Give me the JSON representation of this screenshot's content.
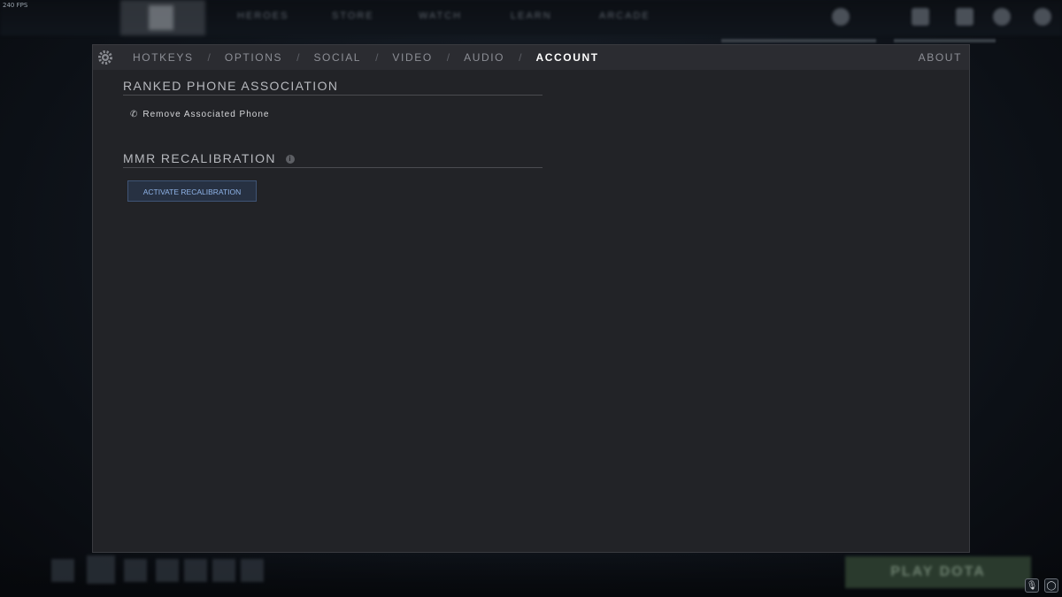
{
  "overlay": {
    "fps": "240 FPS",
    "nav_items": [
      "HEROES",
      "STORE",
      "WATCH",
      "LEARN",
      "ARCADE"
    ],
    "play_button": "PLAY DOTA"
  },
  "settings": {
    "tabs": [
      {
        "label": "HOTKEYS",
        "active": false
      },
      {
        "label": "OPTIONS",
        "active": false
      },
      {
        "label": "SOCIAL",
        "active": false
      },
      {
        "label": "VIDEO",
        "active": false
      },
      {
        "label": "AUDIO",
        "active": false
      },
      {
        "label": "ACCOUNT",
        "active": true
      }
    ],
    "separator": "/",
    "about": "ABOUT",
    "ranked_phone": {
      "title": "RANKED PHONE ASSOCIATION",
      "remove_link": "Remove Associated Phone"
    },
    "mmr": {
      "title": "MMR RECALIBRATION",
      "button": "ACTIVATE RECALIBRATION"
    }
  },
  "colors": {
    "panel_bg": "#222327",
    "header_bg": "#2b2c31",
    "button_bg": "#273142",
    "button_text": "#8fb4e8"
  }
}
